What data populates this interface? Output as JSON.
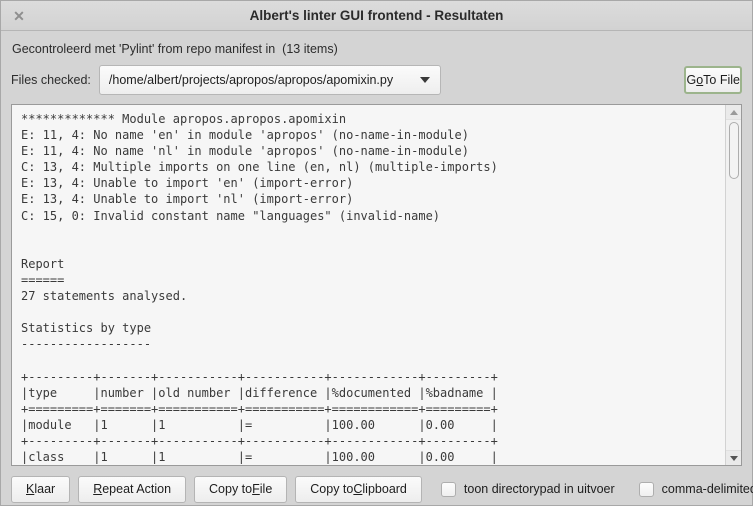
{
  "window": {
    "title": "Albert's linter GUI frontend - Resultaten",
    "close_icon": "close-icon",
    "close_glyph": "✕"
  },
  "header": {
    "subtitle": "Gecontroleerd met 'Pylint' from repo manifest in  (13 items)",
    "file_label": "Files checked:",
    "file_value": "/home/albert/projects/apropos/apropos/apomixin.py",
    "dropdown_icon": "chevron-down-icon",
    "goto_button": {
      "prefix": "G",
      "mnemonic": "o",
      "suffix": " To File"
    }
  },
  "output": {
    "lines": [
      "************* Module apropos.apropos.apomixin",
      "E: 11, 4: No name 'en' in module 'apropos' (no-name-in-module)",
      "E: 11, 4: No name 'nl' in module 'apropos' (no-name-in-module)",
      "C: 13, 4: Multiple imports on one line (en, nl) (multiple-imports)",
      "E: 13, 4: Unable to import 'en' (import-error)",
      "E: 13, 4: Unable to import 'nl' (import-error)",
      "C: 15, 0: Invalid constant name \"languages\" (invalid-name)",
      "",
      "",
      "Report",
      "======",
      "27 statements analysed.",
      "",
      "Statistics by type",
      "------------------",
      "",
      "+---------+-------+-----------+-----------+------------+---------+",
      "|type     |number |old number |difference |%documented |%badname |",
      "+=========+=======+===========+===========+============+=========+",
      "|module   |1      |1          |=          |100.00      |0.00     |",
      "+---------+-------+-----------+-----------+------------+---------+",
      "|class    |1      |1          |=          |100.00      |0.00     |"
    ]
  },
  "scrollbar": {
    "up_icon": "triangle-up-icon",
    "down_icon": "triangle-down-icon"
  },
  "footer": {
    "buttons": [
      {
        "prefix": "",
        "mnemonic": "K",
        "suffix": "laar"
      },
      {
        "prefix": "",
        "mnemonic": "R",
        "suffix": "epeat Action"
      },
      {
        "prefix": "Copy to ",
        "mnemonic": "F",
        "suffix": "ile"
      },
      {
        "prefix": "Copy to ",
        "mnemonic": "C",
        "suffix": "lipboard"
      }
    ],
    "checkboxes": [
      {
        "label": "toon directorypad in uitvoer",
        "checked": false
      },
      {
        "label": "comma-delimited",
        "checked": false
      }
    ]
  },
  "colors": {
    "titlebar": "#d6d6d6",
    "body": "#d4d4d4",
    "textview": "#f6f6f6",
    "focus_border": "#9cb48c",
    "text": "#3a3a3a"
  }
}
